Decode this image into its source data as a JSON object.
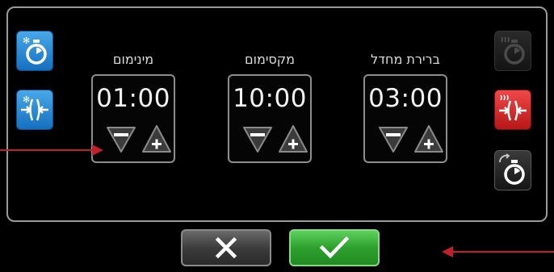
{
  "settings": [
    {
      "label": "מינימום",
      "time": "01:00"
    },
    {
      "label": "מקסימום",
      "time": "10:00"
    },
    {
      "label": "ברירת מחדל",
      "time": "03:00"
    }
  ],
  "left_buttons": [
    {
      "name": "freeze-timer-button",
      "icon": "stopwatch-snowflake-icon",
      "color": "#1f7fd0"
    },
    {
      "name": "freeze-compress-button",
      "icon": "compress-snowflake-icon",
      "color": "#1f7fd0"
    }
  ],
  "right_buttons": [
    {
      "name": "heat-timer-button",
      "icon": "stopwatch-heat-icon",
      "state": "disabled"
    },
    {
      "name": "heat-compress-button",
      "icon": "compress-heat-icon",
      "color": "#d62828",
      "state": "selected"
    },
    {
      "name": "cycle-timer-button",
      "icon": "stopwatch-cycle-icon",
      "color": "#222222"
    }
  ],
  "footer": {
    "cancel_icon": "x-icon",
    "confirm_icon": "checkmark-icon",
    "confirm_color": "#33a833"
  },
  "annotations": {
    "color": "#c0202a"
  }
}
